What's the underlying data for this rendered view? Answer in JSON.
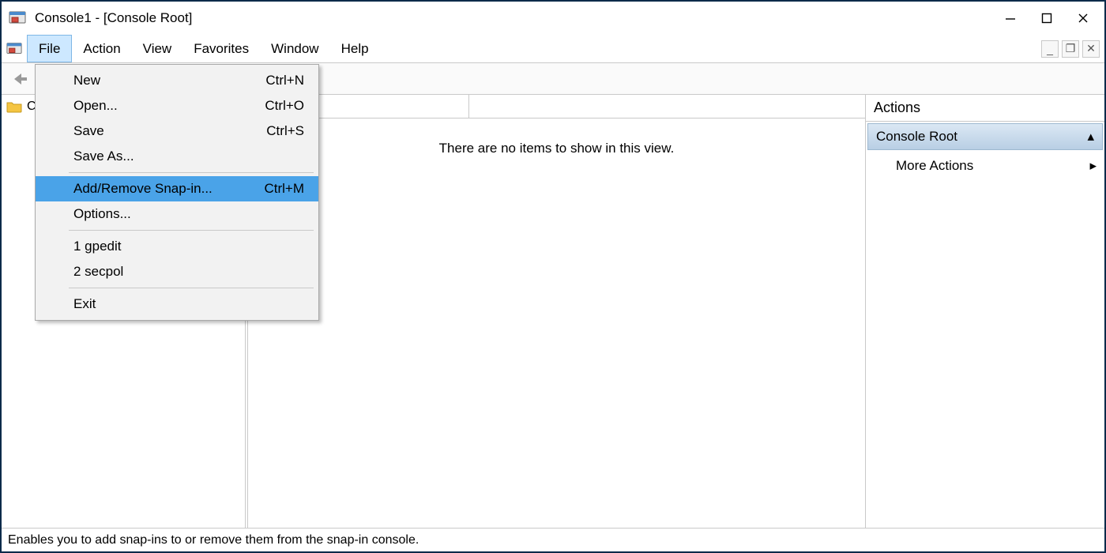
{
  "window": {
    "title": "Console1 - [Console Root]"
  },
  "menubar": {
    "items": [
      "File",
      "Action",
      "View",
      "Favorites",
      "Window",
      "Help"
    ],
    "open_index": 0
  },
  "file_menu": {
    "groups": [
      [
        {
          "label": "New",
          "accel": "Ctrl+N",
          "hl": false
        },
        {
          "label": "Open...",
          "accel": "Ctrl+O",
          "hl": false
        },
        {
          "label": "Save",
          "accel": "Ctrl+S",
          "hl": false
        },
        {
          "label": "Save As...",
          "accel": "",
          "hl": false
        }
      ],
      [
        {
          "label": "Add/Remove Snap-in...",
          "accel": "Ctrl+M",
          "hl": true
        },
        {
          "label": "Options...",
          "accel": "",
          "hl": false
        }
      ],
      [
        {
          "label": "1 gpedit",
          "accel": "",
          "hl": false
        },
        {
          "label": "2 secpol",
          "accel": "",
          "hl": false
        }
      ],
      [
        {
          "label": "Exit",
          "accel": "",
          "hl": false
        }
      ]
    ]
  },
  "tree": {
    "root_label": "Console Root"
  },
  "content": {
    "empty_text": "There are no items to show in this view."
  },
  "actions": {
    "header": "Actions",
    "section": "Console Root",
    "more_actions": "More Actions"
  },
  "statusbar": {
    "text": "Enables you to add snap-ins to or remove them from the snap-in console."
  }
}
